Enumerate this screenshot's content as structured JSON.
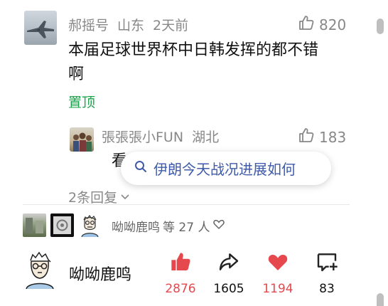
{
  "comment": {
    "username": "郝摇号",
    "location": "山东",
    "time": "2天前",
    "likes": "820",
    "text_line1": "本届足球世界杯中日韩发挥的都不错",
    "text_line2": "啊",
    "pin_label": "置顶"
  },
  "reply": {
    "username": "張張張小FUN",
    "location": "湖北",
    "likes": "183",
    "text_partial": "看"
  },
  "search_suggestion": {
    "text": "伊朗今天战况进展如何"
  },
  "more_replies": "2条回复",
  "likers": {
    "name": "呦呦鹿鸣",
    "count_text": "等 27 人"
  },
  "footer": {
    "author_name": "呦呦鹿鸣",
    "like_count": "2876",
    "share_count": "1605",
    "favorite_count": "1194",
    "comment_count": "83",
    "accent_red": "#e5484d"
  }
}
